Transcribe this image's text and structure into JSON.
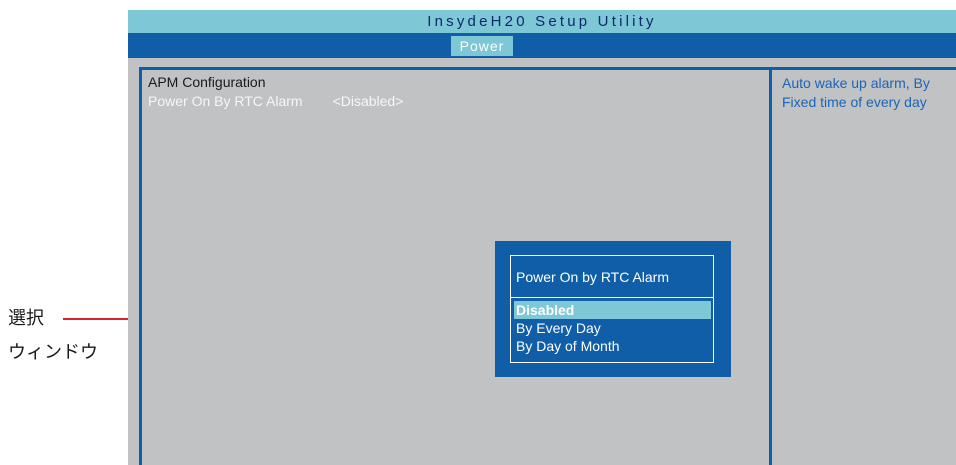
{
  "annotation": {
    "line1": "選択",
    "line2": "ウィンドウ"
  },
  "bios": {
    "title": "InsydeH20 Setup Utility",
    "menu": {
      "active_tab": "Power"
    },
    "left_pane": {
      "section_title": "APM Configuration",
      "setting_label": "Power On By RTC Alarm",
      "setting_value": "<Disabled>"
    },
    "help": {
      "line1": "Auto wake up alarm, By",
      "line2": "Fixed time of every day"
    },
    "popup": {
      "title": "Power On by RTC Alarm",
      "options": [
        "Disabled",
        "By Every Day",
        "By Day of Month"
      ],
      "selected": "Disabled"
    }
  },
  "colors": {
    "accent_blue": "#0f5ea7",
    "accent_cyan": "#7ec7d7",
    "panel_gray": "#c1c2c4",
    "leader_red": "#d9262b"
  }
}
